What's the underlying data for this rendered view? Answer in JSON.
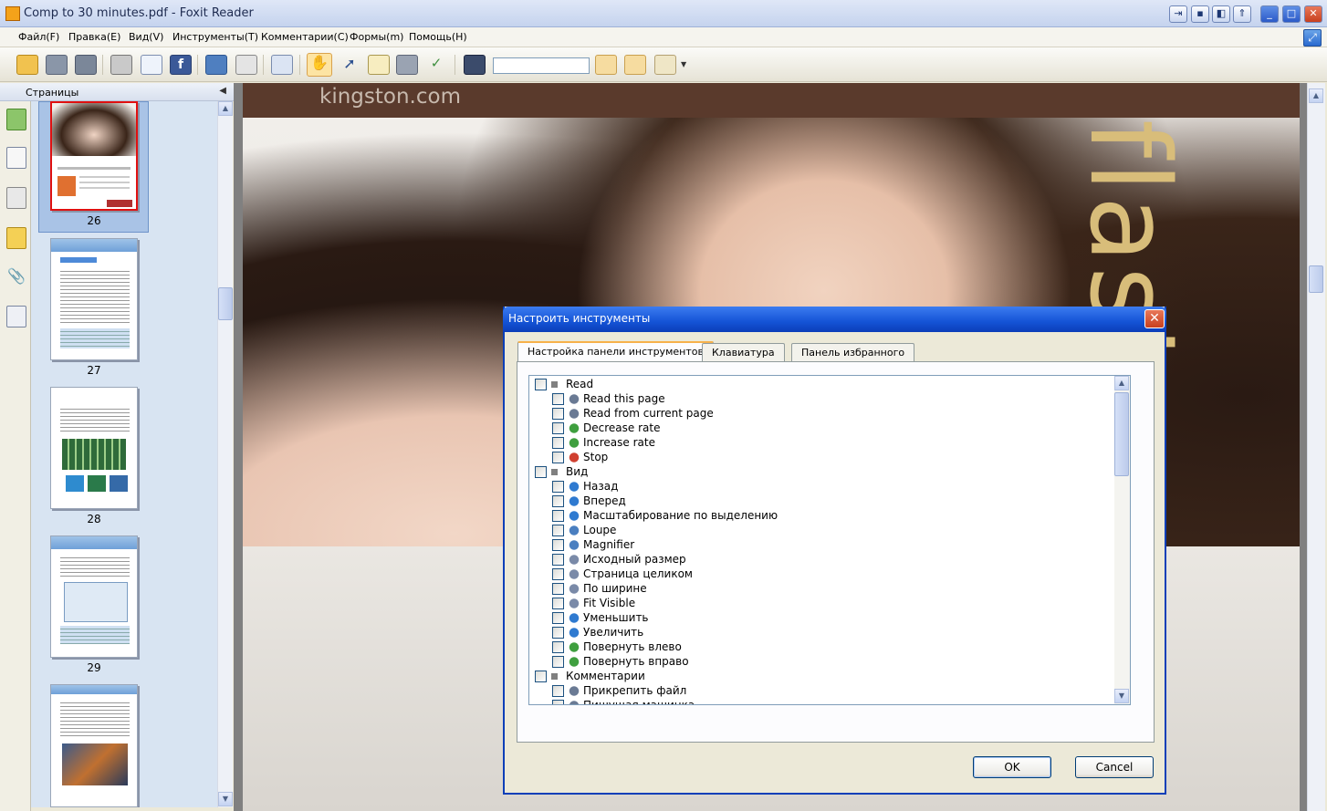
{
  "window": {
    "title": "Comp to 30 minutes.pdf - Foxit Reader"
  },
  "menu": [
    "Файл(F)",
    "Правка(E)",
    "Вид(V)",
    "Инструменты(T)",
    "Комментарии(C)",
    "Формы(m)",
    "Помощь(H)"
  ],
  "search": {
    "value": ""
  },
  "side_panel": {
    "title": "Страницы",
    "pages": [
      "26",
      "27",
      "28",
      "29"
    ],
    "selected_page": "26"
  },
  "document": {
    "header_url": "kingston.com",
    "side_text": "flash"
  },
  "dialog": {
    "title": "Настроить инструменты",
    "tabs": [
      "Настройка панели инструментов",
      "Клавиатура",
      "Панель избранного"
    ],
    "active_tab": "Настройка панели инструментов",
    "tree": [
      {
        "label": "Read",
        "type": "group"
      },
      {
        "label": "Read this page",
        "type": "item"
      },
      {
        "label": "Read from current page",
        "type": "item"
      },
      {
        "label": "Decrease rate",
        "type": "item"
      },
      {
        "label": "Increase rate",
        "type": "item"
      },
      {
        "label": "Stop",
        "type": "item"
      },
      {
        "label": "Вид",
        "type": "group"
      },
      {
        "label": "Назад",
        "type": "item"
      },
      {
        "label": "Вперед",
        "type": "item"
      },
      {
        "label": "Масштабирование по выделению",
        "type": "item"
      },
      {
        "label": "Loupe",
        "type": "item"
      },
      {
        "label": "Magnifier",
        "type": "item"
      },
      {
        "label": "Исходный размер",
        "type": "item"
      },
      {
        "label": "Страница целиком",
        "type": "item"
      },
      {
        "label": "По ширине",
        "type": "item"
      },
      {
        "label": "Fit Visible",
        "type": "item"
      },
      {
        "label": "Уменьшить",
        "type": "item"
      },
      {
        "label": "Увеличить",
        "type": "item"
      },
      {
        "label": "Повернуть влево",
        "type": "item"
      },
      {
        "label": "Повернуть вправо",
        "type": "item"
      },
      {
        "label": "Комментарии",
        "type": "group"
      },
      {
        "label": "Прикрепить файл",
        "type": "item"
      },
      {
        "label": "Пишущая машинка",
        "type": "item"
      }
    ],
    "ok_label": "OK",
    "cancel_label": "Cancel"
  }
}
